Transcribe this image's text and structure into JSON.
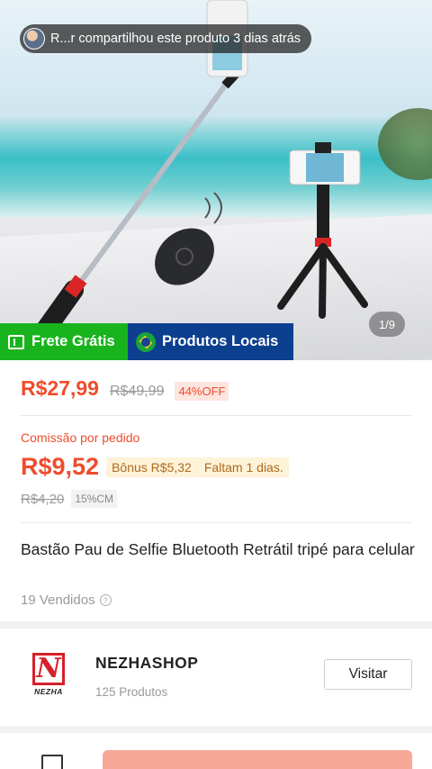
{
  "share_banner": {
    "text": "R...r compartilhou este produto 3 dias atrás"
  },
  "gallery": {
    "counter": "1/9"
  },
  "badges": {
    "free_shipping": "Frete Grátis",
    "local_products": "Produtos Locais"
  },
  "pricing": {
    "price": "R$27,99",
    "original_price": "R$49,99",
    "discount": "44%OFF",
    "commission_label": "Comissão por pedido",
    "commission": "R$9,52",
    "bonus": "Bônus R$5,32",
    "remaining": "Faltam 1 dias.",
    "commission_old": "R$4,20",
    "commission_rate": "15%CM"
  },
  "product": {
    "title": "Bastão Pau de Selfie Bluetooth Retrátil tripé para celular",
    "sold": "19 Vendidos"
  },
  "shop": {
    "logo_letter": "N",
    "logo_text": "NEZHA",
    "name": "NEZHASHOP",
    "products": "125 Produtos",
    "visit_label": "Visitar"
  },
  "colors": {
    "accent": "#ee4d2d",
    "free_badge": "#19b41d",
    "local_badge": "#0d3f8f",
    "bonus_bg": "#fdf3d8"
  }
}
